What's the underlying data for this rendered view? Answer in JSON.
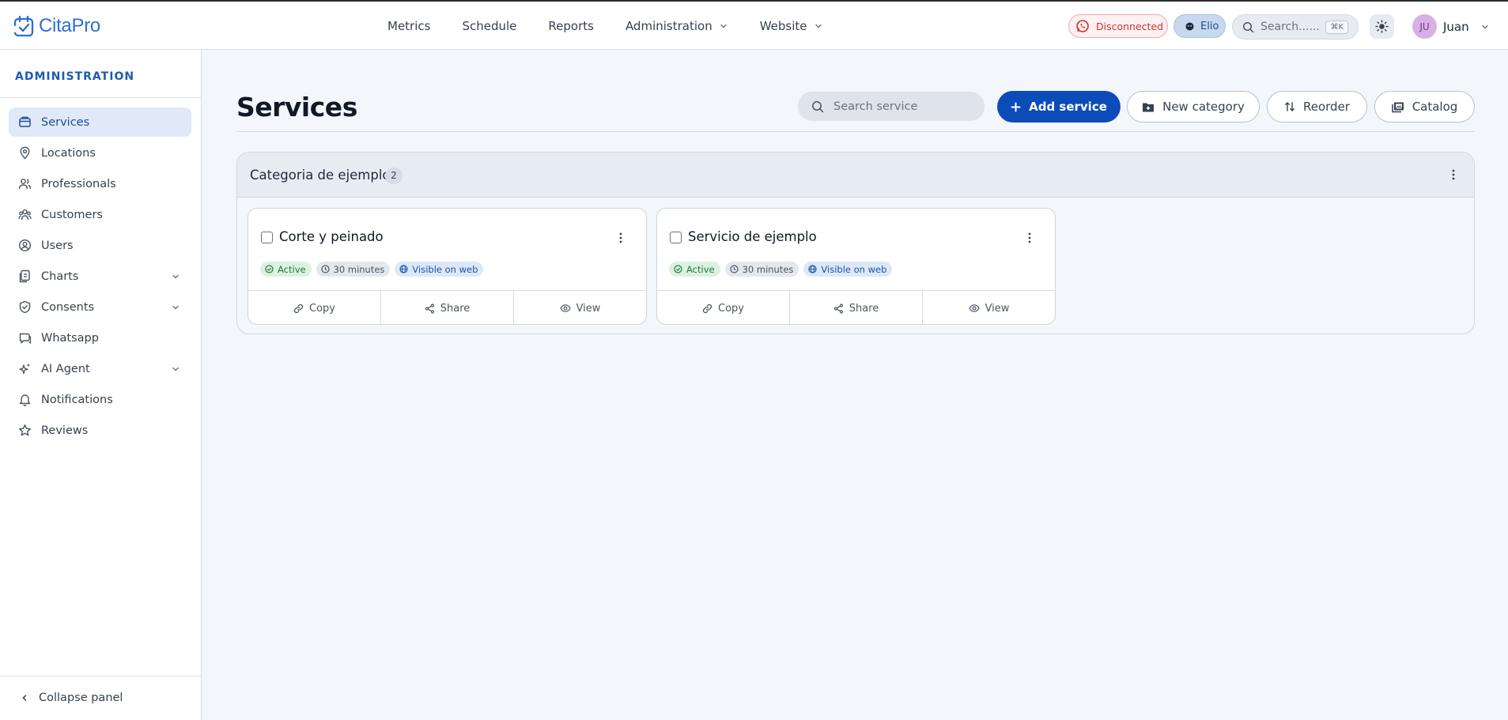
{
  "app": {
    "name": "CitaPro"
  },
  "nav": {
    "items": [
      {
        "label": "Metrics",
        "has_dropdown": false
      },
      {
        "label": "Schedule",
        "has_dropdown": false
      },
      {
        "label": "Reports",
        "has_dropdown": false
      },
      {
        "label": "Administration",
        "has_dropdown": true
      },
      {
        "label": "Website",
        "has_dropdown": true
      }
    ]
  },
  "header": {
    "whatsapp_status": "Disconnected",
    "assistant_label": "Elio",
    "search_placeholder": "Search......",
    "search_shortcut": "⌘K",
    "user_initials": "JU",
    "user_name": "Juan"
  },
  "sidebar": {
    "heading": "ADMINISTRATION",
    "items": [
      {
        "label": "Services",
        "icon": "box-icon",
        "active": true,
        "expandable": false
      },
      {
        "label": "Locations",
        "icon": "map-pin-icon",
        "active": false,
        "expandable": false
      },
      {
        "label": "Professionals",
        "icon": "users-icon",
        "active": false,
        "expandable": false
      },
      {
        "label": "Customers",
        "icon": "customers-icon",
        "active": false,
        "expandable": false
      },
      {
        "label": "Users",
        "icon": "user-circle-icon",
        "active": false,
        "expandable": false
      },
      {
        "label": "Charts",
        "icon": "charts-icon",
        "active": false,
        "expandable": true
      },
      {
        "label": "Consents",
        "icon": "shield-check-icon",
        "active": false,
        "expandable": true
      },
      {
        "label": "Whatsapp",
        "icon": "chat-icon",
        "active": false,
        "expandable": false
      },
      {
        "label": "AI Agent",
        "icon": "sparkles-icon",
        "active": false,
        "expandable": true
      },
      {
        "label": "Notifications",
        "icon": "bell-icon",
        "active": false,
        "expandable": false
      },
      {
        "label": "Reviews",
        "icon": "star-icon",
        "active": false,
        "expandable": false
      }
    ],
    "collapse_label": "Collapse panel"
  },
  "main": {
    "title": "Services",
    "search_placeholder": "Search service",
    "buttons": {
      "add_service": "Add service",
      "new_category": "New category",
      "reorder": "Reorder",
      "catalog": "Catalog"
    },
    "category": {
      "name": "Categoria de ejemplo",
      "count": "2",
      "services": [
        {
          "name": "Corte y peinado",
          "status": "Active",
          "duration": "30 minutes",
          "visibility": "Visible on web",
          "actions": [
            "Copy",
            "Share",
            "View"
          ]
        },
        {
          "name": "Servicio de ejemplo",
          "status": "Active",
          "duration": "30 minutes",
          "visibility": "Visible on web",
          "actions": [
            "Copy",
            "Share",
            "View"
          ]
        }
      ]
    }
  },
  "colors": {
    "brand": "#2e6fd1",
    "primary_button": "#0c4cb8",
    "danger": "#d12f2f",
    "success": "#1f7a3c"
  }
}
